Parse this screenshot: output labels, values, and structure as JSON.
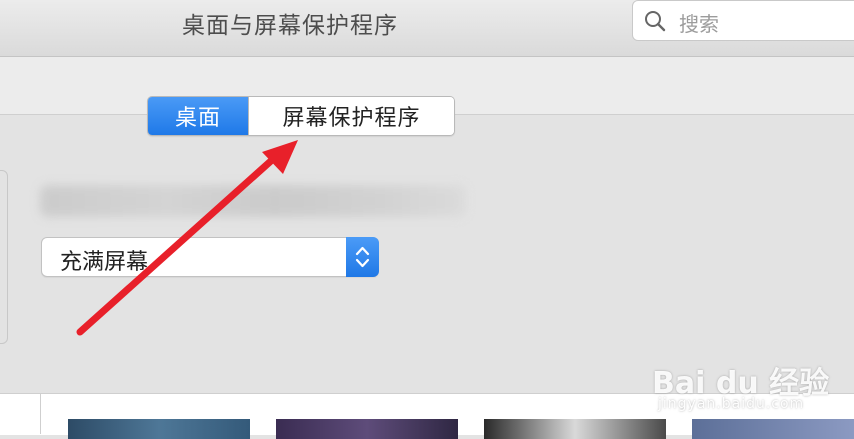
{
  "window": {
    "title": "桌面与屏幕保护程序"
  },
  "search": {
    "placeholder": "搜索"
  },
  "tabs": [
    {
      "label": "桌面",
      "selected": true
    },
    {
      "label": "屏幕保护程序",
      "selected": false
    }
  ],
  "desktop": {
    "fill_mode": "充满屏幕"
  },
  "watermark": {
    "brand": "Bai du 经验",
    "sub": "jingyan.baidu.com"
  },
  "colors": {
    "accent": "#1f79e8",
    "arrow": "#e8202a"
  }
}
